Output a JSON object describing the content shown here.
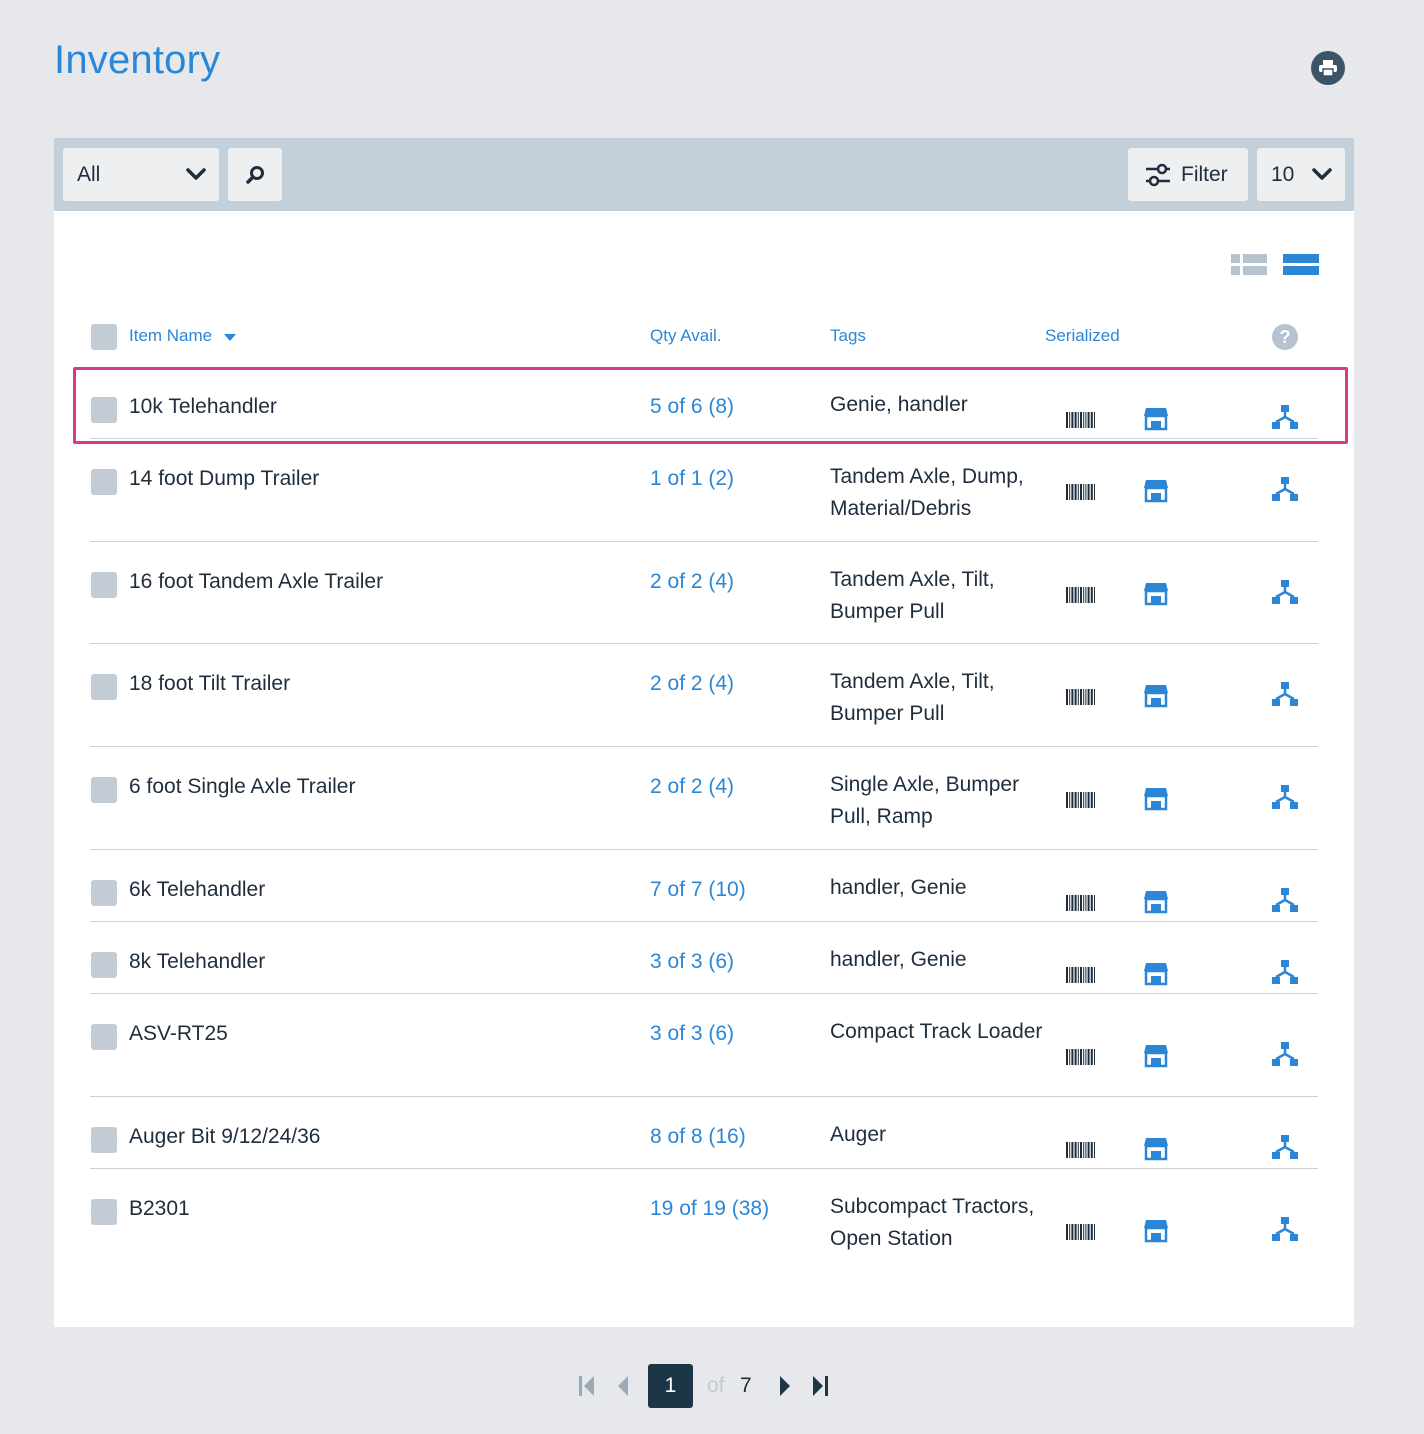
{
  "page": {
    "title": "Inventory"
  },
  "toolbar": {
    "select_value": "All",
    "filter_label": "Filter",
    "per_page": "10"
  },
  "table": {
    "columns": {
      "item_name": "Item Name",
      "qty": "Qty Avail.",
      "tags": "Tags",
      "serialized": "Serialized"
    },
    "rows": [
      {
        "name": "10k Telehandler",
        "qty": "5 of 6 (8)",
        "tags": "Genie, handler"
      },
      {
        "name": "14 foot Dump Trailer",
        "qty": "1 of 1 (2)",
        "tags": "Tandem Axle, Dump, Material/Debris"
      },
      {
        "name": "16 foot Tandem Axle Trailer",
        "qty": "2 of 2 (4)",
        "tags": "Tandem Axle, Tilt, Bumper Pull"
      },
      {
        "name": "18 foot Tilt Trailer",
        "qty": "2 of 2 (4)",
        "tags": "Tandem Axle, Tilt, Bumper Pull"
      },
      {
        "name": "6 foot Single Axle Trailer",
        "qty": "2 of 2 (4)",
        "tags": "Single Axle, Bumper Pull, Ramp"
      },
      {
        "name": "6k Telehandler",
        "qty": "7 of 7 (10)",
        "tags": "handler, Genie"
      },
      {
        "name": "8k Telehandler",
        "qty": "3 of 3 (6)",
        "tags": "handler, Genie"
      },
      {
        "name": "ASV-RT25",
        "qty": "3 of 3 (6)",
        "tags": "Compact Track Loader"
      },
      {
        "name": "Auger Bit 9/12/24/36",
        "qty": "8 of 8 (16)",
        "tags": "Auger"
      },
      {
        "name": "B2301",
        "qty": "19 of 19 (38)",
        "tags": "Subcompact Tractors, Open Station"
      }
    ]
  },
  "pagination": {
    "current": "1",
    "of_label": "of",
    "total": "7"
  },
  "colors": {
    "accent": "#2b87d6",
    "dark": "#1c3547",
    "highlight": "#d63b85"
  },
  "icons": [
    "print-icon",
    "chevron-down-icon",
    "search-icon",
    "filter-sliders-icon",
    "list-view-icon",
    "row-view-icon",
    "help-icon",
    "barcode-icon",
    "store-icon",
    "hierarchy-icon",
    "first-page-icon",
    "prev-page-icon",
    "next-page-icon",
    "last-page-icon"
  ]
}
